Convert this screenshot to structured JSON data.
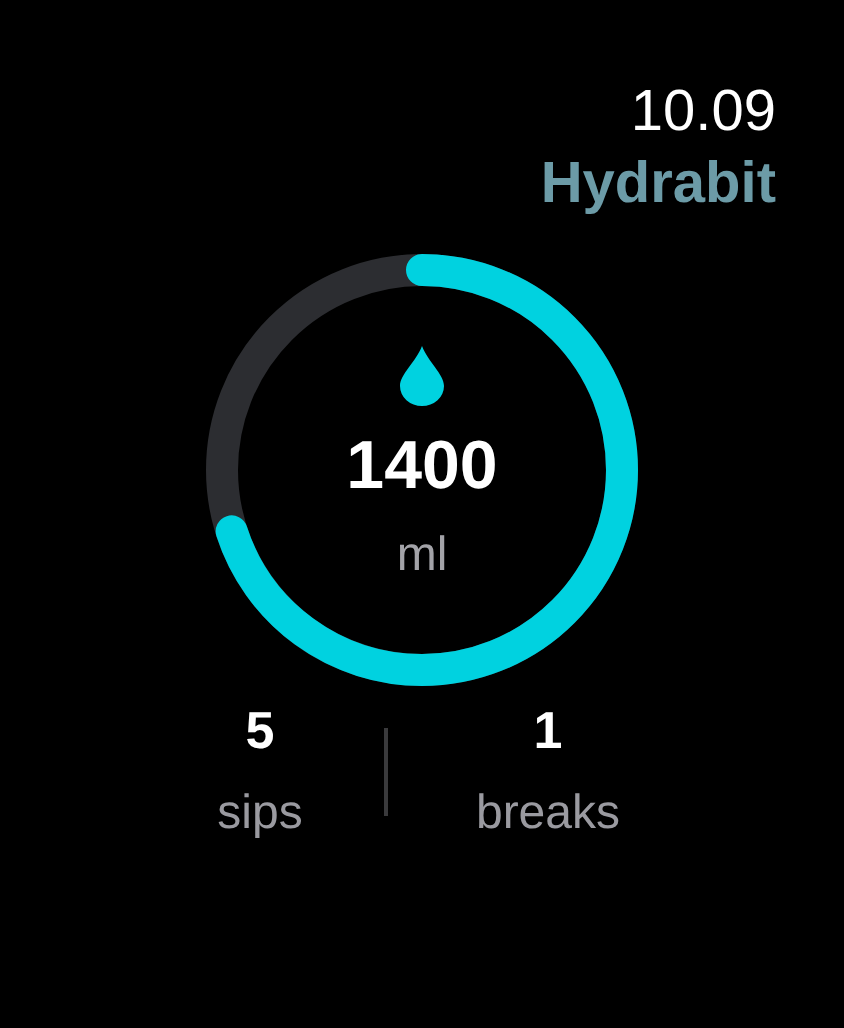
{
  "header": {
    "time": "10.09",
    "app_title": "Hydrabit"
  },
  "intake": {
    "amount": "1400",
    "unit": "ml"
  },
  "stats": [
    {
      "value": "5",
      "label": "sips"
    },
    {
      "value": "1",
      "label": "breaks"
    }
  ]
}
